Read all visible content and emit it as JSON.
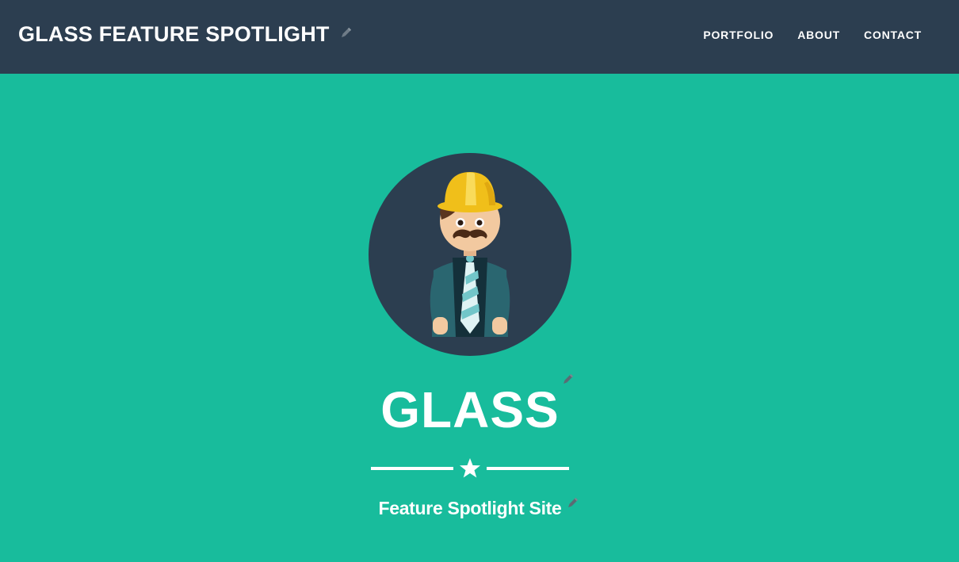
{
  "navbar": {
    "brand": "GLASS FEATURE SPOTLIGHT",
    "links": [
      {
        "label": "PORTFOLIO"
      },
      {
        "label": "ABOUT"
      },
      {
        "label": "CONTACT"
      }
    ]
  },
  "hero": {
    "title": "GLASS",
    "subtitle": "Feature Spotlight Site",
    "icons": {
      "avatar": "construction-worker-avatar",
      "divider": "star-icon",
      "edit": "pencil-icon"
    }
  },
  "colors": {
    "navbar_bg": "#2c3e50",
    "hero_bg": "#18bc9c",
    "avatar_bg": "#2c3e50",
    "text": "#ffffff"
  }
}
